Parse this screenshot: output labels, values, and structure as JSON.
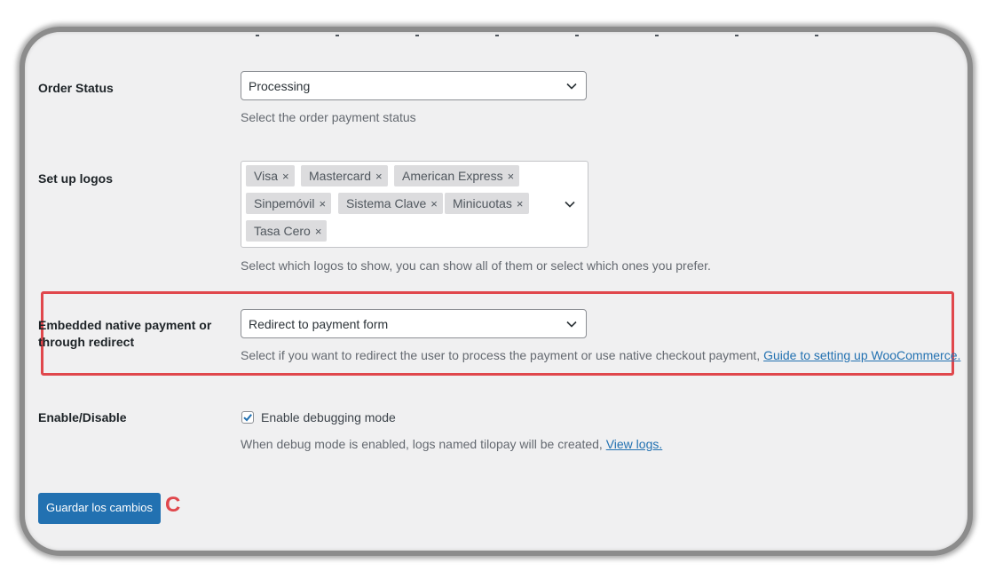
{
  "order_status": {
    "label": "Order Status",
    "selected": "Processing",
    "description": "Select the order payment status"
  },
  "logos": {
    "label": "Set up logos",
    "tags": [
      "Visa",
      "Mastercard",
      "American Express",
      "Sinpemóvil",
      "Sistema Clave",
      "Minicuotas",
      "Tasa Cero"
    ],
    "remove_glyph": "×",
    "description": "Select which logos to show, you can show all of them or select which ones you prefer."
  },
  "embedded": {
    "label_line1": "Embedded native payment or",
    "label_line2": "through redirect",
    "selected": "Redirect to payment form",
    "description": "Select if you want to redirect the user to process the payment or use native checkout payment, ",
    "link": "Guide to setting up WooCommerce."
  },
  "debug": {
    "label": "Enable/Disable",
    "checkbox_label": "Enable debugging mode",
    "checked": true,
    "description": "When debug mode is enabled, logs named tilopay will be created, ",
    "link": "View logs."
  },
  "save_button": "Guardar los cambios",
  "annotation_marker": "C",
  "colors": {
    "accent": "#2271b1",
    "highlight": "#e0474c",
    "background": "#f0f0f1"
  },
  "icons": [
    "chevron-down-icon",
    "remove-icon",
    "checkmark-icon"
  ]
}
